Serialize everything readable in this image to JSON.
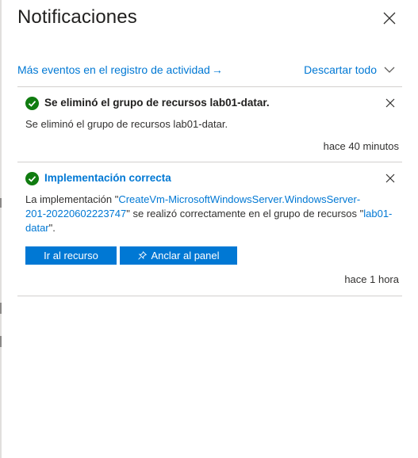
{
  "panel": {
    "title": "Notificaciones",
    "activity_link": "Más eventos en el registro de actividad",
    "activity_arrow": "→",
    "dismiss_all": "Descartar todo"
  },
  "notifications": [
    {
      "title": "Se eliminó el grupo de recursos lab01-datar.",
      "body": "Se eliminó el grupo de recursos lab01-datar.",
      "time": "hace 40 minutos",
      "status": "success"
    },
    {
      "title": "Implementación correcta",
      "body_prefix": "La implementación \"",
      "deployment_name_line1": "CreateVm-MicrosoftWindowsServer.WindowsServer-",
      "deployment_name_line2": "201-20220602223747",
      "body_middle": "\" se realizó correctamente en el grupo de recursos \"",
      "resource_group_line1": "lab01-",
      "resource_group_line2": "datar",
      "body_suffix": "\".",
      "buttons": {
        "go_to_resource": "Ir al recurso",
        "pin_to_dashboard": "Anclar al panel"
      },
      "time": "hace 1 hora",
      "status": "success"
    }
  ],
  "colors": {
    "accent": "#0078d4",
    "success": "#107c10",
    "divider": "#d2d0ce"
  },
  "icons": {
    "close": "close-icon",
    "chevron": "chevron-down-icon",
    "success": "success-check-icon",
    "pin": "pin-icon"
  }
}
